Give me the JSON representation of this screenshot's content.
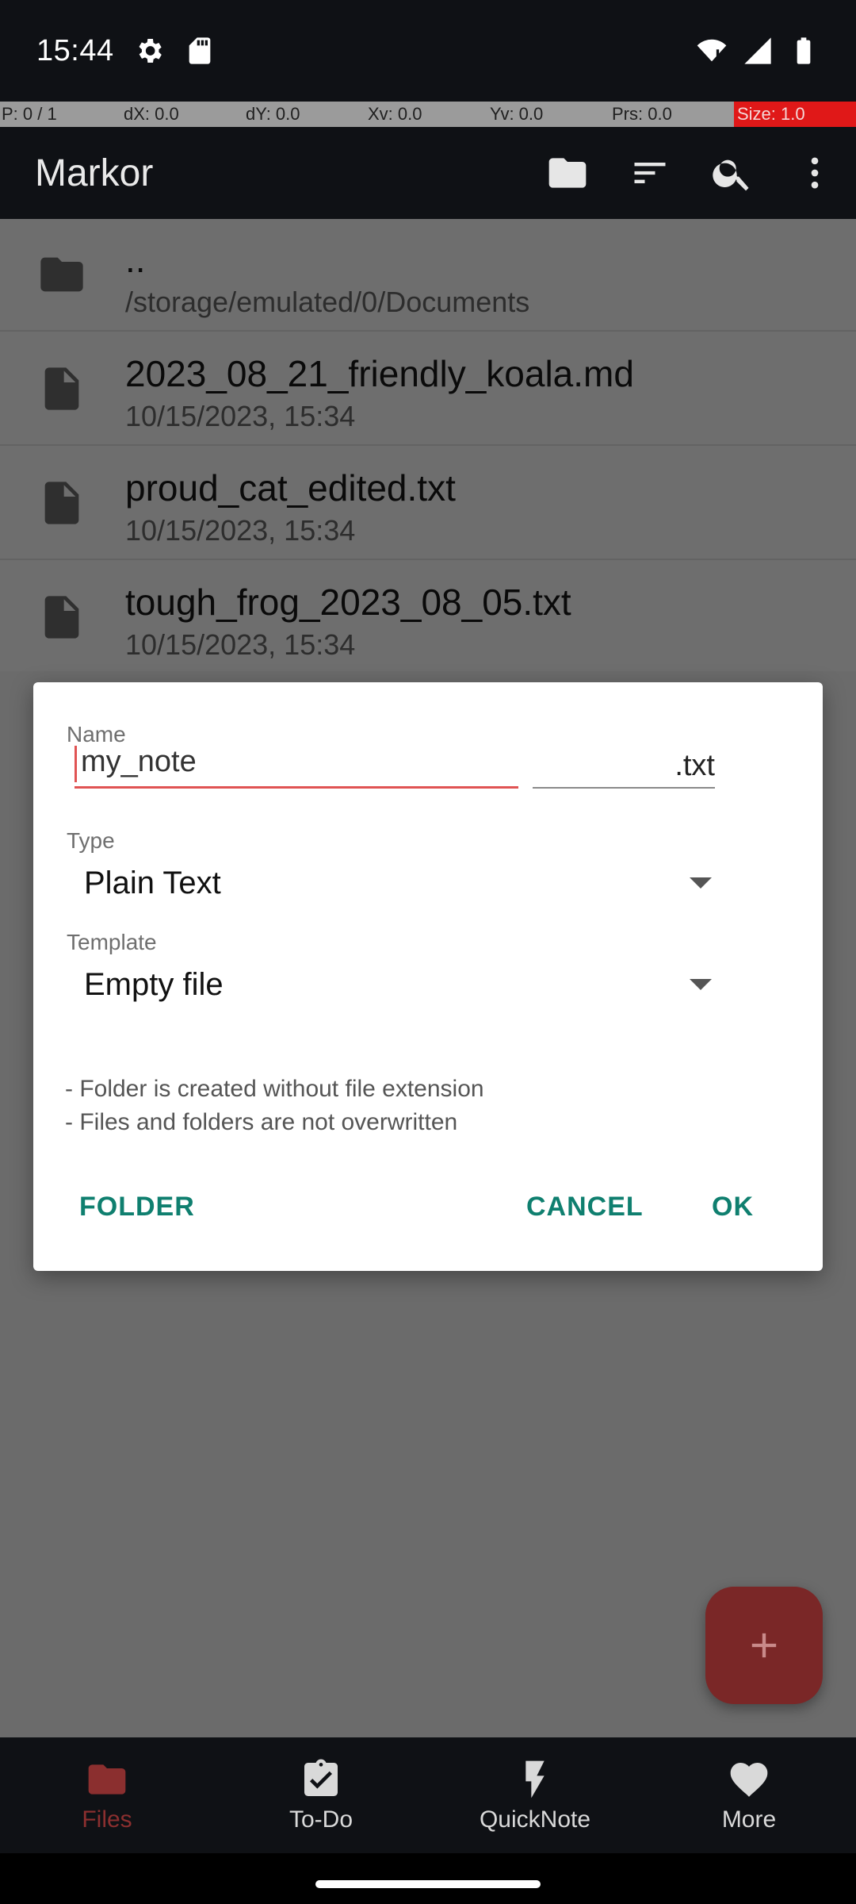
{
  "status_bar": {
    "time": "15:44",
    "icons": [
      "settings-icon",
      "sd-card-icon",
      "wifi-icon",
      "signal-icon",
      "battery-icon"
    ]
  },
  "pointer_overlay": {
    "p": "P: 0 / 1",
    "dx": "dX: 0.0",
    "dy": "dY: 0.0",
    "xv": "Xv: 0.0",
    "yv": "Yv: 0.0",
    "prs": "Prs: 0.0",
    "size": "Size: 1.0"
  },
  "app_bar": {
    "title": "Markor",
    "actions": [
      "folder-icon",
      "sort-icon",
      "search-icon",
      "more-vert-icon"
    ]
  },
  "file_list": {
    "items": [
      {
        "name": "..",
        "subtitle": "/storage/emulated/0/Documents",
        "icon": "folder-icon"
      },
      {
        "name": "2023_08_21_friendly_koala.md",
        "subtitle": "10/15/2023, 15:34",
        "icon": "file-icon"
      },
      {
        "name": "proud_cat_edited.txt",
        "subtitle": "10/15/2023, 15:34",
        "icon": "file-icon"
      },
      {
        "name": "tough_frog_2023_08_05.txt",
        "subtitle": "10/15/2023, 15:34",
        "icon": "file-icon"
      }
    ]
  },
  "dialog": {
    "name_label": "Name",
    "name_value": "my_note",
    "extension": ".txt",
    "type_label": "Type",
    "type_value": "Plain Text",
    "template_label": "Template",
    "template_value": "Empty file",
    "hints": [
      "- Folder is created without file extension",
      "- Files and folders are not overwritten"
    ],
    "buttons": {
      "folder": "FOLDER",
      "cancel": "CANCEL",
      "ok": "OK"
    }
  },
  "fab": {
    "icon": "plus-icon"
  },
  "bottom_nav": {
    "items": [
      {
        "label": "Files",
        "icon": "folder-icon",
        "active": true
      },
      {
        "label": "To-Do",
        "icon": "clipboard-check-icon",
        "active": false
      },
      {
        "label": "QuickNote",
        "icon": "bolt-icon",
        "active": false
      },
      {
        "label": "More",
        "icon": "heart-icon",
        "active": false
      }
    ]
  },
  "colors": {
    "accent_teal": "#0f7f6f",
    "accent_red": "#e05353",
    "brand_dark_red": "#7a2727",
    "bar_bg": "#0f1115"
  }
}
